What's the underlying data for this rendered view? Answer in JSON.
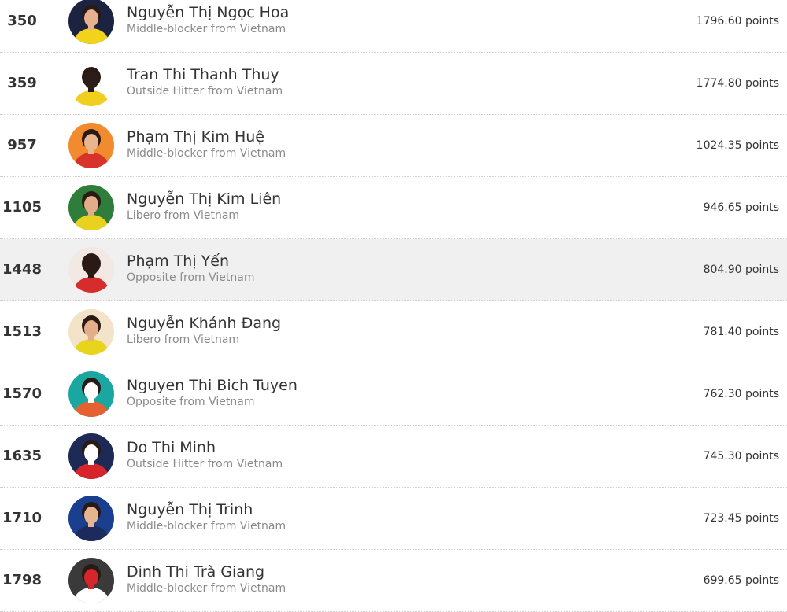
{
  "players": [
    {
      "rank": "350",
      "name": "Nguyễn Thị Ngọc Hoa",
      "role": "Middle-blocker from Vietnam",
      "points": "1796.60 points",
      "avatar": "player-photo",
      "avatar_colors": [
        "#1b2340",
        "#f3d21b",
        "#e6b18f"
      ]
    },
    {
      "rank": "359",
      "name": "Tran Thi Thanh Thuy",
      "role": "Outside Hitter from Vietnam",
      "points": "1774.80 points",
      "avatar": "player-photo",
      "avatar_colors": [
        "#ffffff",
        "#f0cf1e",
        "#2b1d18"
      ]
    },
    {
      "rank": "957",
      "name": "Phạm Thị Kim Huệ",
      "role": "Middle-blocker from Vietnam",
      "points": "1024.35 points",
      "avatar": "player-photo",
      "avatar_colors": [
        "#f28a2e",
        "#d8332a",
        "#e9b58f"
      ]
    },
    {
      "rank": "1105",
      "name": "Nguyễn Thị Kim Liên",
      "role": "Libero from Vietnam",
      "points": "946.65 points",
      "avatar": "player-photo",
      "avatar_colors": [
        "#2f7d3a",
        "#e8d21e",
        "#e2ad88"
      ]
    },
    {
      "rank": "1448",
      "name": "Phạm Thị Yến",
      "role": "Opposite from Vietnam",
      "points": "804.90 points",
      "avatar": "player-photo",
      "avatar_colors": [
        "#f2e9e4",
        "#d72c2c",
        "#2a1a16"
      ]
    },
    {
      "rank": "1513",
      "name": "Nguyễn Khánh Đang",
      "role": "Libero from Vietnam",
      "points": "781.40 points",
      "avatar": "player-photo",
      "avatar_colors": [
        "#f3e3c8",
        "#e8d41d",
        "#e4ae8a"
      ]
    },
    {
      "rank": "1570",
      "name": "Nguyen Thi Bich Tuyen",
      "role": "Opposite from Vietnam",
      "points": "762.30 points",
      "avatar": "player-photo",
      "avatar_colors": [
        "#1aa6a1",
        "#e5612f",
        "#ffffff"
      ]
    },
    {
      "rank": "1635",
      "name": "Do Thi Minh",
      "role": "Outside Hitter from Vietnam",
      "points": "745.30 points",
      "avatar": "player-photo",
      "avatar_colors": [
        "#1c2a55",
        "#d7262b",
        "#ffffff"
      ]
    },
    {
      "rank": "1710",
      "name": "Nguyễn Thị Trinh",
      "role": "Middle-blocker from Vietnam",
      "points": "723.45 points",
      "avatar": "player-photo",
      "avatar_colors": [
        "#1b3f8f",
        "#1c2a5c",
        "#e6b48f"
      ]
    },
    {
      "rank": "1798",
      "name": "Dinh Thi Trà Giang",
      "role": "Middle-blocker from Vietnam",
      "points": "699.65 points",
      "avatar": "player-photo",
      "avatar_colors": [
        "#3a3a3a",
        "#ffffff",
        "#d7262b"
      ]
    }
  ],
  "highlight_index": 4,
  "colors": {
    "text": "#333333",
    "subtext": "#8a8a8a",
    "highlight_bg": "#f0f0f0",
    "divider": "#cfcfcf"
  }
}
